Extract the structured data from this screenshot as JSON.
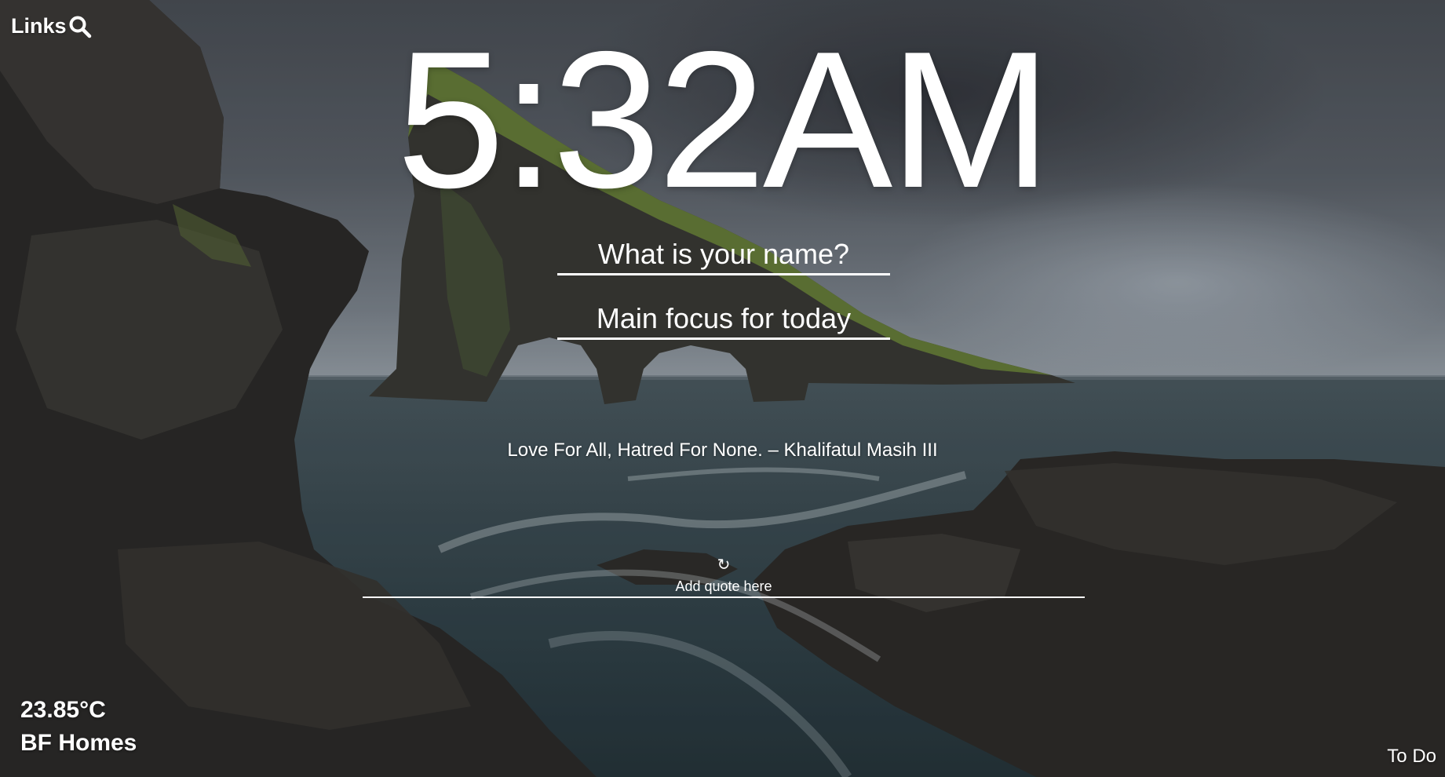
{
  "header": {
    "links_label": "Links",
    "search_icon": "search-icon"
  },
  "clock": {
    "time": "5:32AM"
  },
  "name_input": {
    "placeholder": "What is your name?",
    "value": ""
  },
  "focus_input": {
    "placeholder": "Main focus for today",
    "value": ""
  },
  "quote": {
    "text": "Love For All, Hatred For None. – Khalifatul Masih III"
  },
  "add_quote": {
    "refresh_icon": "refresh-icon",
    "refresh_glyph": "↻",
    "placeholder": "Add quote here",
    "value": ""
  },
  "weather": {
    "temperature": "23.85°C",
    "location": "BF Homes"
  },
  "footer": {
    "todo_label": "To Do"
  },
  "colors": {
    "text": "#ffffff",
    "sky": "#5b6169",
    "sea": "#2f4047",
    "rock": "#2c2b2a",
    "grass": "#6f8a3a"
  }
}
